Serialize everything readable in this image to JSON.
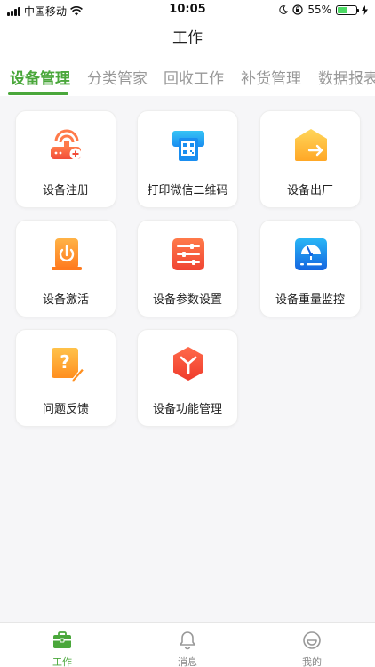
{
  "status_bar": {
    "carrier": "中国移动",
    "time": "10:05",
    "battery": "55%",
    "battery_level": 0.55
  },
  "header": {
    "title": "工作"
  },
  "tabs": [
    {
      "label": "设备管理",
      "active": true
    },
    {
      "label": "分类管家",
      "active": false
    },
    {
      "label": "回收工作",
      "active": false
    },
    {
      "label": "补货管理",
      "active": false
    },
    {
      "label": "数据报表",
      "active": false
    }
  ],
  "grid": {
    "items": [
      {
        "label": "设备注册",
        "icon": "router-register-icon"
      },
      {
        "label": "打印微信二维码",
        "icon": "print-qrcode-icon"
      },
      {
        "label": "设备出厂",
        "icon": "house-export-icon"
      },
      {
        "label": "设备激活",
        "icon": "device-activate-icon"
      },
      {
        "label": "设备参数设置",
        "icon": "sliders-settings-icon"
      },
      {
        "label": "设备重量监控",
        "icon": "weight-gauge-icon"
      },
      {
        "label": "问题反馈",
        "icon": "question-edit-icon"
      },
      {
        "label": "设备功能管理",
        "icon": "cube-function-icon"
      }
    ]
  },
  "bottom_nav": [
    {
      "label": "工作",
      "icon": "briefcase-icon",
      "active": true
    },
    {
      "label": "消息",
      "icon": "bell-icon",
      "active": false
    },
    {
      "label": "我的",
      "icon": "smiley-profile-icon",
      "active": false
    }
  ],
  "colors": {
    "accent": "#4aa73b",
    "inactive_text": "#999999",
    "background": "#f6f6f8"
  }
}
